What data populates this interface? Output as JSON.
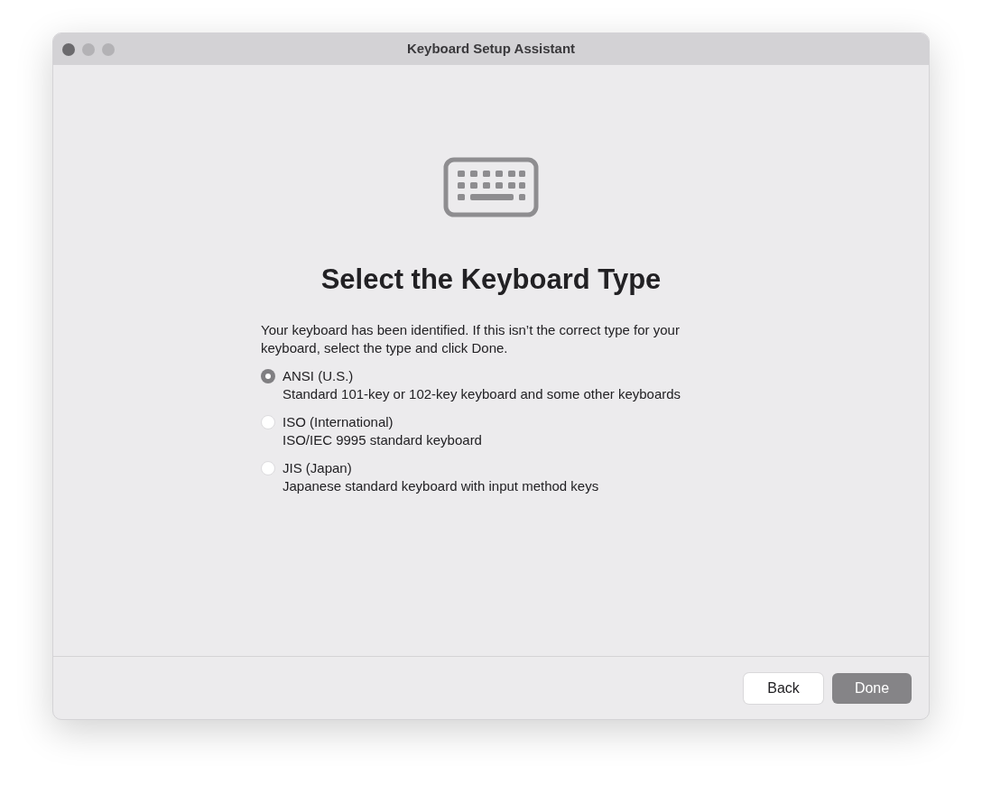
{
  "window": {
    "title": "Keyboard Setup Assistant"
  },
  "heading": "Select the Keyboard Type",
  "intro": "Your keyboard has been identified. If this isn’t the correct type for your keyboard, select the type and click Done.",
  "options": [
    {
      "label": "ANSI (U.S.)",
      "description": "Standard 101-key or 102-key keyboard and some other keyboards",
      "selected": true
    },
    {
      "label": "ISO (International)",
      "description": "ISO/IEC 9995 standard keyboard",
      "selected": false
    },
    {
      "label": "JIS (Japan)",
      "description": "Japanese standard keyboard with input method keys",
      "selected": false
    }
  ],
  "buttons": [
    {
      "label": "Back",
      "default": false
    },
    {
      "label": "Done",
      "default": true
    }
  ]
}
